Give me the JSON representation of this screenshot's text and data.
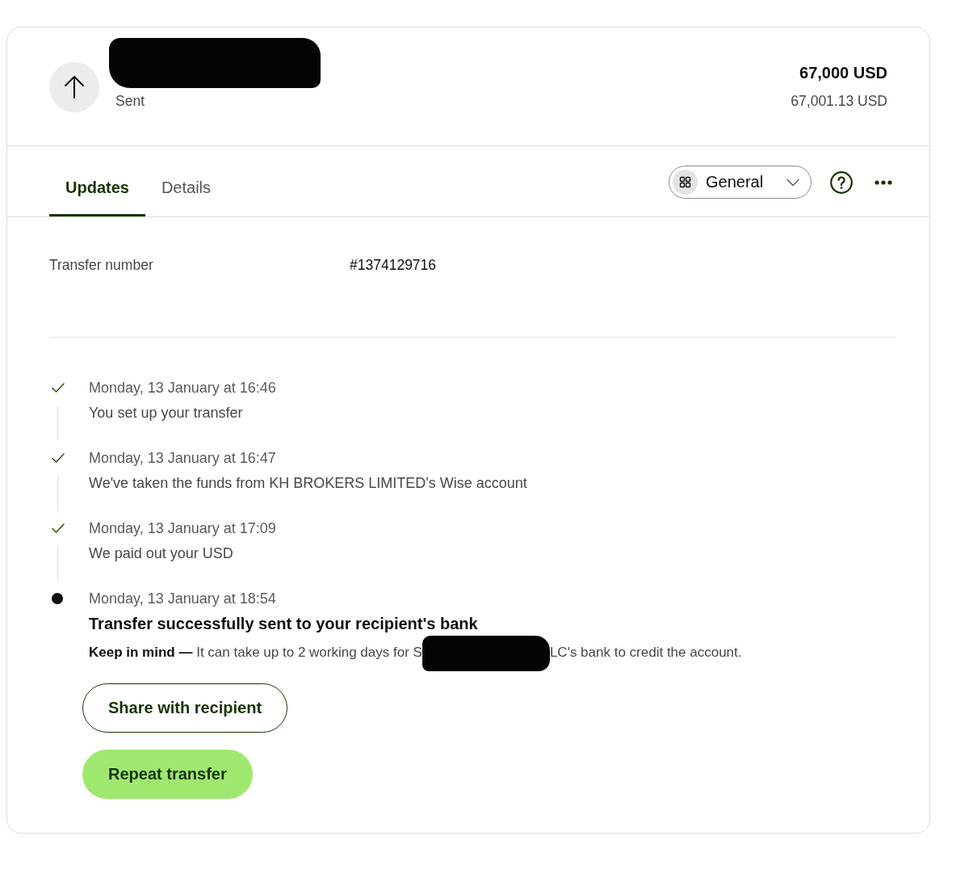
{
  "header": {
    "status": "Sent",
    "amount": "67,000 USD",
    "amount_detail": "67,001.13 USD"
  },
  "tabs": [
    {
      "label": "Updates",
      "selected": true
    },
    {
      "label": "Details",
      "selected": false
    }
  ],
  "filter": {
    "label": "General"
  },
  "details": [
    {
      "label": "Transfer number",
      "value": "#1374129716"
    }
  ],
  "timeline": [
    {
      "kind": "done",
      "date": "Monday, 13 January at 16:46",
      "text": "You set up your transfer"
    },
    {
      "kind": "done",
      "date": "Monday, 13 January at 16:47",
      "text": "We've taken the funds from KH BROKERS LIMITED's Wise account"
    },
    {
      "kind": "done",
      "date": "Monday, 13 January at 17:09",
      "text": "We paid out your USD"
    },
    {
      "kind": "current",
      "date": "Monday, 13 January at 18:54",
      "title": "Transfer successfully sent to your recipient's bank",
      "note_before": "**Keep in mind —** It can take up to 2 working days for S",
      "note_after": "LC's bank to credit the account."
    }
  ],
  "buttons": [
    {
      "kind": "outline",
      "label": "Share with recipient"
    },
    {
      "kind": "primary",
      "label": "Repeat transfer"
    }
  ]
}
